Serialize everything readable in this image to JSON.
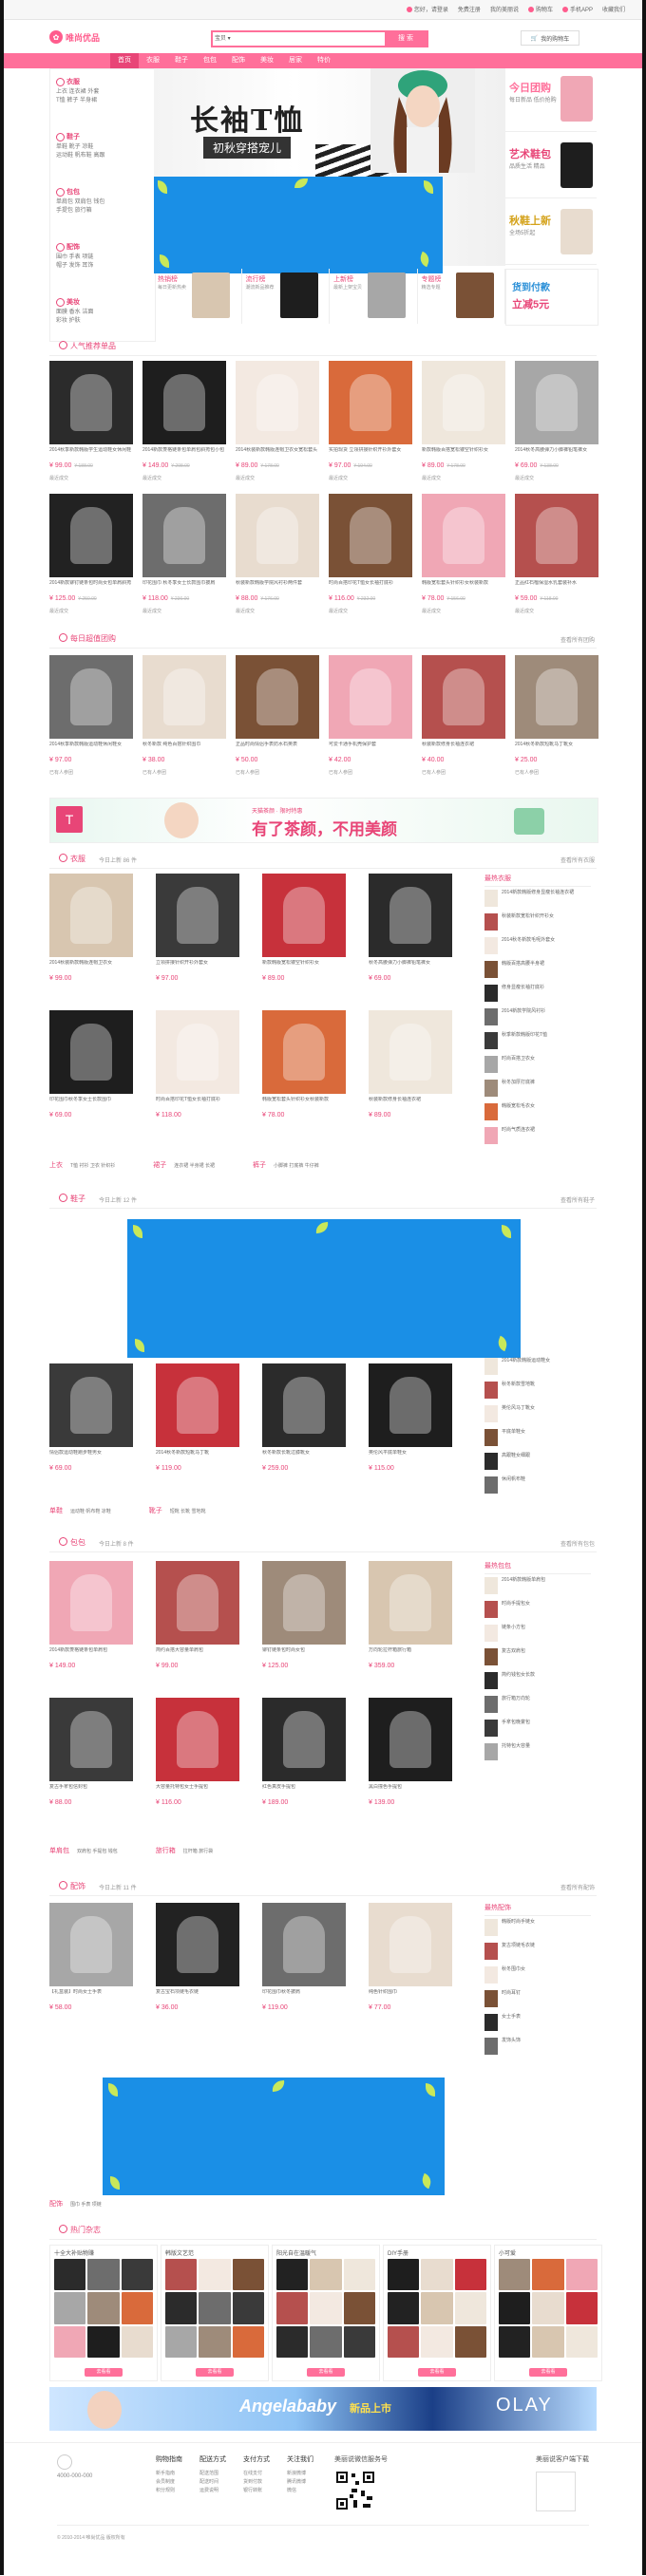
{
  "topbar": {
    "links": [
      "您好，请登录",
      "免费注册",
      "我的美丽说",
      "购物车",
      "手机APP",
      "收藏我们"
    ]
  },
  "header": {
    "logo_text": "唯尚优品",
    "search": {
      "category": "宝贝",
      "placeholder": "",
      "button": "搜 索"
    },
    "cart_label": "我的购物车"
  },
  "nav": {
    "items": [
      "首页",
      "衣服",
      "鞋子",
      "包包",
      "配饰",
      "美妆",
      "居家",
      "特价"
    ],
    "active": 0
  },
  "sidebar": {
    "blocks": [
      {
        "title": "衣服",
        "lines": [
          "上衣  连衣裙  外套",
          "T恤  裤子  半身裙"
        ]
      },
      {
        "title": "鞋子",
        "lines": [
          "单鞋  靴子  凉鞋",
          "运动鞋  帆布鞋  高跟"
        ]
      },
      {
        "title": "包包",
        "lines": [
          "单肩包  双肩包  钱包",
          "手提包  旅行箱"
        ]
      },
      {
        "title": "配饰",
        "lines": [
          "围巾  手表  项链",
          "帽子  发饰  耳饰"
        ]
      },
      {
        "title": "美妆",
        "lines": [
          "面膜  香水  洁面",
          "彩妆  护肤"
        ]
      }
    ]
  },
  "banner": {
    "title": "长袖T恤",
    "subtitle": "初秋穿搭宠儿"
  },
  "promos": [
    {
      "title": "今日团购",
      "sub": "每日新品  低价抢购",
      "color": "#ff6f9a"
    },
    {
      "title": "艺术鞋包",
      "sub": "品质生活  精品",
      "color": "#e84577"
    },
    {
      "title": "秋鞋上新",
      "sub": "全场5折起",
      "color": "#d4a21a"
    }
  ],
  "thumbstrip": [
    {
      "label": "热销榜",
      "sub": "每日更新热卖"
    },
    {
      "label": "流行榜",
      "sub": "潮流新品推荐"
    },
    {
      "label": "上新榜",
      "sub": "最新上架宝贝"
    },
    {
      "label": "专题榜",
      "sub": "精选专题"
    }
  ],
  "payad": {
    "title": "货到付款",
    "sub": "立减5元"
  },
  "sections": {
    "popular": {
      "title": "人气推荐单品",
      "more": ""
    },
    "daily": {
      "title": "每日超值团购",
      "more": "查看所有团购"
    },
    "clothes": {
      "title": "衣服",
      "sub": "今日上新 86 件",
      "more": "查看所有衣服",
      "side_title": "最热衣服"
    },
    "shoes": {
      "title": "鞋子",
      "sub": "今日上新 12 件",
      "more": "查看所有鞋子"
    },
    "bags": {
      "title": "包包",
      "sub": "今日上新 8 件",
      "more": "查看所有包包",
      "side_title": "最热包包"
    },
    "acc": {
      "title": "配饰",
      "sub": "今日上新 11 件",
      "more": "查看所有配饰",
      "side_title": "最热配饰"
    },
    "hot": {
      "title": "热门杂志"
    }
  },
  "popular_products": [
    {
      "desc": "2014秋季新款韩版学生运动鞋女休闲鞋",
      "price": "¥ 99.00",
      "old": "¥ 188.00",
      "sold": "最近成交"
    },
    {
      "desc": "2014新款菱格链条包单肩包斜挎包小包",
      "price": "¥ 149.00",
      "old": "¥ 298.00",
      "sold": "最近成交"
    },
    {
      "desc": "2014秋装新款韩版连帽卫衣女宽松套头",
      "price": "¥ 89.00",
      "old": "¥ 178.00",
      "sold": "最近成交"
    },
    {
      "desc": "实拍现货 立领拼接针织开衫外套女",
      "price": "¥ 97.00",
      "old": "¥ 194.00",
      "sold": "最近成交"
    },
    {
      "desc": "新款韩版百搭宽松镂空针织衫女",
      "price": "¥ 89.00",
      "old": "¥ 178.00",
      "sold": "最近成交"
    },
    {
      "desc": "2014秋冬高腰弹力小脚裤铅笔裤女",
      "price": "¥ 69.00",
      "old": "¥ 138.00",
      "sold": "最近成交"
    },
    {
      "desc": "2014新款铆钉链条包时尚女包单肩斜挎",
      "price": "¥ 125.00",
      "old": "¥ 250.00",
      "sold": "最近成交"
    },
    {
      "desc": "印花围巾 秋冬季女士长款围巾披肩",
      "price": "¥ 118.00",
      "old": "¥ 236.00",
      "sold": "最近成交"
    },
    {
      "desc": "秋装新款韩版学院风衬衫两件套",
      "price": "¥ 88.00",
      "old": "¥ 176.00",
      "sold": "最近成交"
    },
    {
      "desc": "时尚百搭印花T恤女长袖打底衫",
      "price": "¥ 116.00",
      "old": "¥ 232.00",
      "sold": "最近成交"
    },
    {
      "desc": "韩版宽松套头针织衫女秋装新款",
      "price": "¥ 78.00",
      "old": "¥ 156.00",
      "sold": "最近成交"
    },
    {
      "desc": "正品红石榴保湿水乳套装补水",
      "price": "¥ 59.00",
      "old": "¥ 118.00",
      "sold": "最近成交"
    }
  ],
  "daily_products": [
    {
      "desc": "2014秋季新款韩版运动鞋休闲鞋女",
      "price": "¥ 97.00",
      "sold": "已有人参团"
    },
    {
      "desc": "秋冬新款 纯色百搭针织围巾",
      "price": "¥ 38.00",
      "sold": "已有人参团"
    },
    {
      "desc": "正品时尚情侣手表防水石英表",
      "price": "¥ 50.00",
      "sold": "已有人参团"
    },
    {
      "desc": "可爱卡通手机壳保护套",
      "price": "¥ 42.00",
      "sold": "已有人参团"
    },
    {
      "desc": "秋装新款修身长袖连衣裙",
      "price": "¥ 40.00",
      "sold": "已有人参团"
    },
    {
      "desc": "2014秋冬新款短靴马丁靴女",
      "price": "¥ 25.00",
      "sold": "已有人参团"
    }
  ],
  "adbar": {
    "text": "有了茶颜，不用美颜",
    "small": "天猫茶颜 · 限时特惠"
  },
  "clothes_products": [
    {
      "desc": "2014秋装新款韩版连帽卫衣女",
      "price": "¥ 99.00"
    },
    {
      "desc": "立领拼接针织开衫外套女",
      "price": "¥ 97.00"
    },
    {
      "desc": "新款韩版宽松镂空针织衫女",
      "price": "¥ 89.00"
    },
    {
      "desc": "秋冬高腰弹力小脚裤铅笔裤女",
      "price": "¥ 69.00"
    },
    {
      "desc": "印花围巾秋冬季女士长款围巾",
      "price": "¥ 69.00"
    },
    {
      "desc": "时尚百搭印花T恤女长袖打底衫",
      "price": "¥ 118.00"
    },
    {
      "desc": "韩版宽松套头针织衫女秋装新款",
      "price": "¥ 78.00"
    },
    {
      "desc": "秋装新款修身长袖连衣裙",
      "price": "¥ 89.00"
    }
  ],
  "clothes_side": [
    "2014新款韩版修身显瘦长袖连衣裙",
    "秋装新款宽松针织开衫女",
    "2014秋冬新款毛呢外套女",
    "韩版百搭高腰半身裙",
    "修身显瘦长袖打底衫",
    "2014新款学院风衬衫",
    "秋季新款韩版印花T恤",
    "时尚百搭卫衣女",
    "秋冬加厚打底裤",
    "韩版宽松毛衣女",
    "时尚气质连衣裙"
  ],
  "clothes_tags": [
    "上衣",
    "T恤 衬衫 卫衣 针织衫",
    "裙子",
    "连衣裙 半身裙 长裙",
    "裤子",
    "小脚裤 打底裤 牛仔裤"
  ],
  "shoes_products": [
    {
      "desc": "情侣款运动鞋跑步鞋男女",
      "price": "¥ 69.00"
    },
    {
      "desc": "2014秋冬新款短靴马丁靴",
      "price": "¥ 119.00"
    },
    {
      "desc": "秋冬新款长靴过膝靴女",
      "price": "¥ 259.00"
    },
    {
      "desc": "英伦风平底单鞋女",
      "price": "¥ 115.00"
    }
  ],
  "shoes_side": [
    "2014新款韩版运动鞋女",
    "秋冬新款雪地靴",
    "英伦风马丁靴女",
    "平底单鞋女",
    "高跟鞋女细跟",
    "休闲帆布鞋"
  ],
  "shoes_tags": [
    "单鞋",
    "运动鞋 帆布鞋 凉鞋",
    "靴子",
    "短靴 长靴 雪地靴"
  ],
  "bags_products": [
    {
      "desc": "2014新款菱格链条包单肩包",
      "price": "¥ 149.00"
    },
    {
      "desc": "简约百搭大容量单肩包",
      "price": "¥ 99.00"
    },
    {
      "desc": "铆钉链条包时尚女包",
      "price": "¥ 125.00"
    },
    {
      "desc": "万向轮拉杆箱旅行箱",
      "price": "¥ 359.00"
    },
    {
      "desc": "复古手拿包信封包",
      "price": "¥ 88.00"
    },
    {
      "desc": "大容量托特包女士手提包",
      "price": "¥ 116.00"
    },
    {
      "desc": "红色真皮手提包",
      "price": "¥ 189.00"
    },
    {
      "desc": "黑白撞色手提包",
      "price": "¥ 139.00"
    }
  ],
  "bags_side": [
    "2014新款韩版单肩包",
    "时尚手提包女",
    "链条小方包",
    "复古双肩包",
    "简约钱包女长款",
    "旅行箱万向轮",
    "手拿包晚宴包",
    "托特包大容量"
  ],
  "bags_tags": [
    "单肩包",
    "双肩包 手提包 钱包",
    "旅行箱",
    "拉杆箱 旅行袋"
  ],
  "acc_products": [
    {
      "desc": "【礼盒装】时尚女士手表",
      "price": "¥ 58.00"
    },
    {
      "desc": "复古宝石项链毛衣链",
      "price": "¥ 36.00"
    },
    {
      "desc": "印花围巾秋冬披肩",
      "price": "¥ 119.00"
    },
    {
      "desc": "纯色针织围巾",
      "price": "¥ 77.00"
    }
  ],
  "acc_side": [
    "韩版时尚手链女",
    "复古项链毛衣链",
    "秋冬围巾女",
    "时尚耳钉",
    "女士手表",
    "发饰头饰"
  ],
  "acc_tags": [
    "配饰",
    "围巾 手表 项链"
  ],
  "hot_magazines": [
    {
      "title": "十全大补贴物赚",
      "btn": "去看看"
    },
    {
      "title": "韩版文艺范",
      "btn": "去看看"
    },
    {
      "title": "阳光自在温暖气",
      "btn": "去看看"
    },
    {
      "title": "DIY手册",
      "btn": "去看看"
    },
    {
      "title": "小可爱",
      "btn": "去看看"
    }
  ],
  "footer_band": {
    "left": "Angelababy",
    "mid": "新品上市",
    "right": "OLAY"
  },
  "footer": {
    "cols": [
      {
        "title": "购物指南",
        "items": [
          "新手指南",
          "会员制度",
          "积分规则"
        ]
      },
      {
        "title": "配送方式",
        "items": [
          "配送范围",
          "配送时间",
          "运费说明"
        ]
      },
      {
        "title": "支付方式",
        "items": [
          "在线支付",
          "货到付款",
          "银行转账"
        ]
      },
      {
        "title": "关注我们",
        "items": [
          "新浪微博",
          "腾讯微博",
          "微信"
        ]
      }
    ],
    "app_title": "美丽说微信服务号",
    "download": "美丽说客户端下载",
    "phone": "4000-000-000",
    "copyright": "© 2010-2014 唯尚优品 版权所有"
  }
}
